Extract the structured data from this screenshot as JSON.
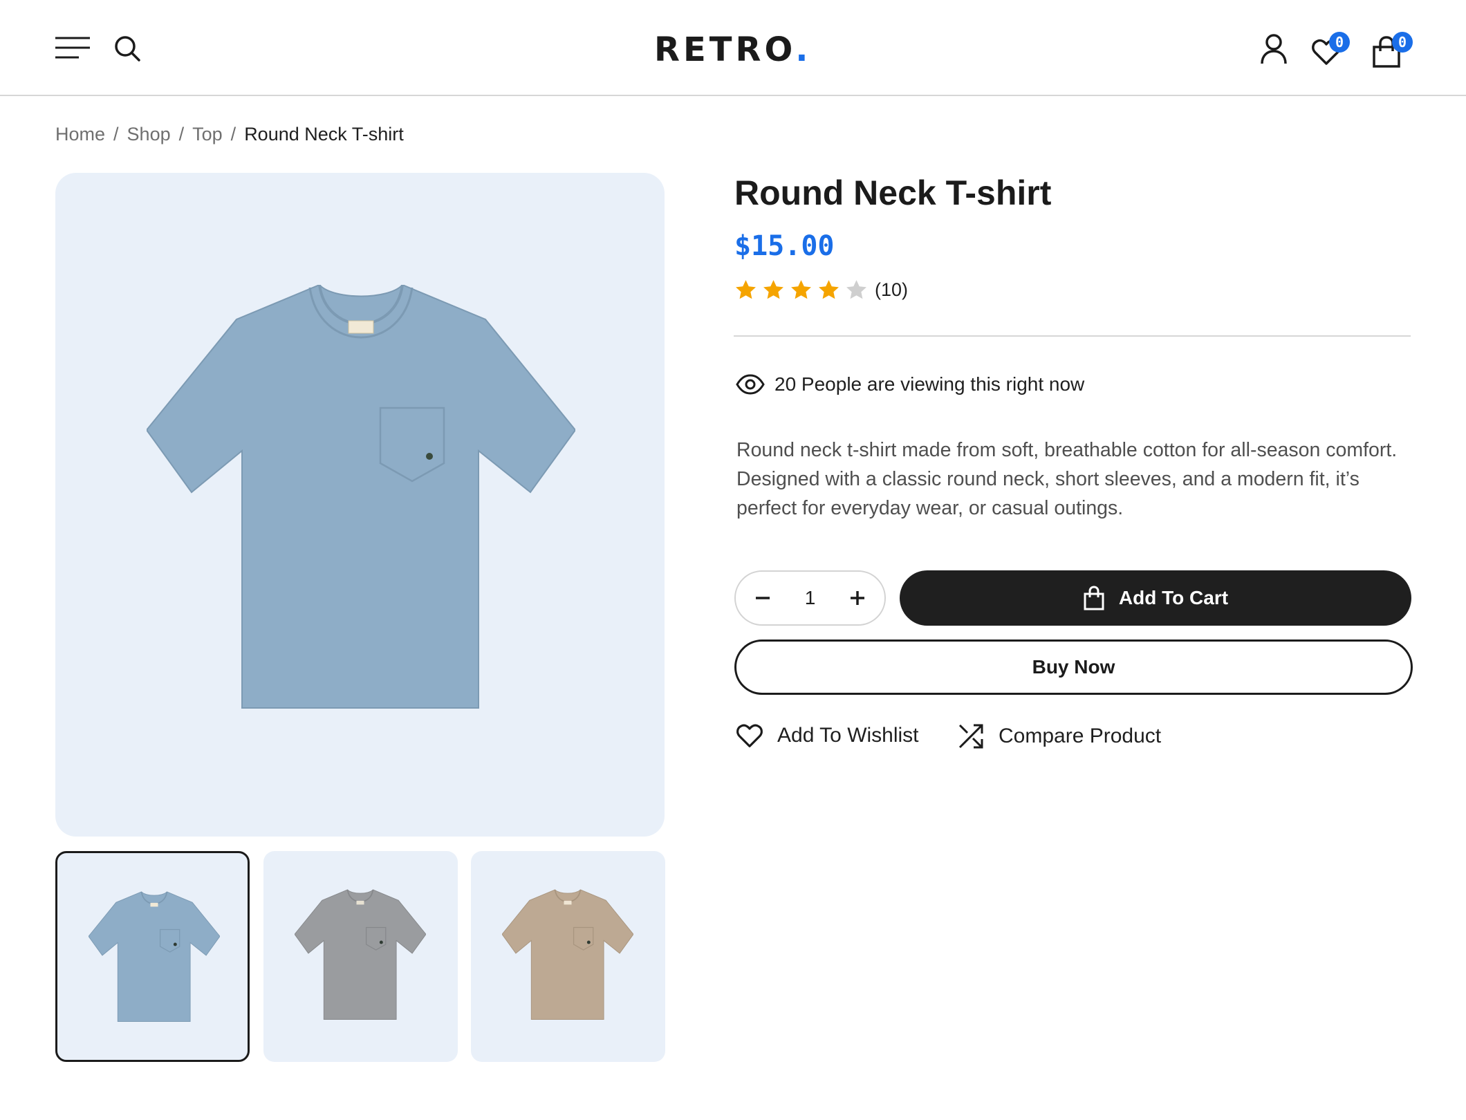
{
  "header": {
    "logo_text": "RETRO",
    "logo_dot": ".",
    "wishlist_count": "0",
    "cart_count": "0",
    "accent_color": "#1a6ee8"
  },
  "breadcrumb": {
    "items": [
      "Home",
      "Shop",
      "Top"
    ],
    "separator": "/",
    "current": "Round Neck T-shirt"
  },
  "gallery": {
    "main_color": "#8eadc7",
    "thumbnails": [
      {
        "color": "#8eadc7",
        "active": true
      },
      {
        "color": "#9a9c9f",
        "active": false
      },
      {
        "color": "#bda993",
        "active": false
      }
    ]
  },
  "product": {
    "title": "Round Neck T-shirt",
    "price": "$15.00",
    "rating": 4,
    "rating_max": 5,
    "review_count": "(10)",
    "viewers_text": "20 People are viewing this right now",
    "description": "Round neck t-shirt made from soft, breathable cotton for all-season comfort. Designed with a classic round neck, short sleeves, and a modern fit, it’s perfect for everyday wear, or casual outings."
  },
  "actions": {
    "quantity": "1",
    "add_to_cart": "Add To Cart",
    "buy_now": "Buy Now",
    "add_to_wishlist": "Add To Wishlist",
    "compare_product": "Compare Product"
  },
  "icons": {
    "menu": "menu-icon",
    "search": "search-icon",
    "user": "user-icon",
    "wishlist": "heart-icon",
    "cart": "shopping-bag-icon",
    "viewers": "eye-icon",
    "compare": "shuffle-icon",
    "star_color": "#f5a400",
    "star_empty_color": "#cfcfcf"
  }
}
